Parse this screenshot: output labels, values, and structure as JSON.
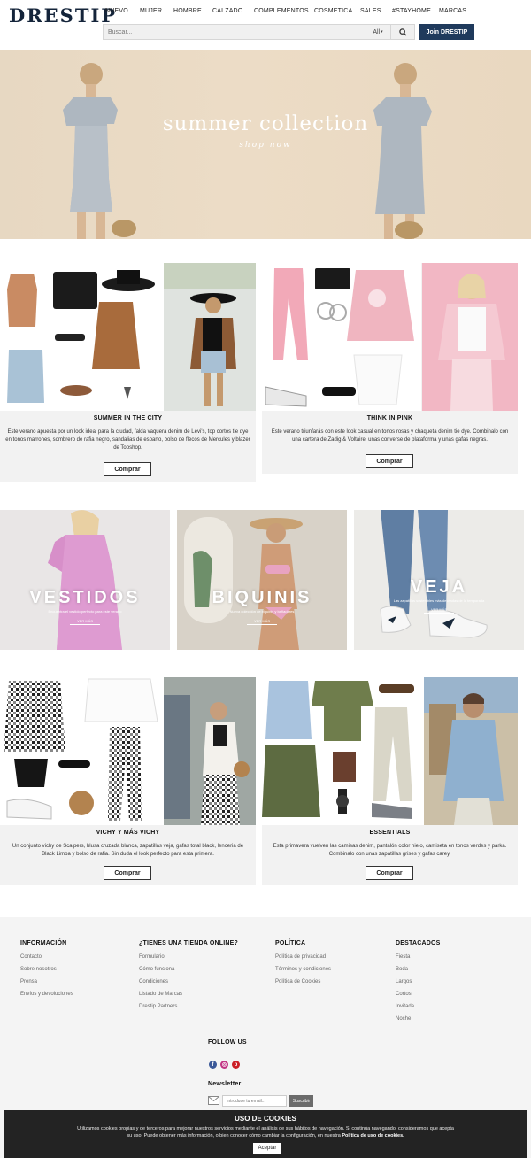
{
  "header": {
    "logo": "DRESTIP",
    "nav": [
      "NUEVO",
      "MUJER",
      "HOMBRE",
      "CALZADO",
      "COMPLEMENTOS",
      "COSMETICA",
      "SALES",
      "#STAYHOME",
      "MARCAS"
    ],
    "search_placeholder": "Buscar...",
    "search_scope": "All",
    "join_label": "Join DRESTIP"
  },
  "hero": {
    "title": "summer collection",
    "subtitle": "shop now"
  },
  "looks": [
    {
      "title": "SUMMER IN THE CITY",
      "desc": "Este verano apuesta por un look ideal para la ciudad, falda vaquera denim de Levi's, top cortos tie dye en tonos marrones, sombrero de rafia negro, sandalias de esparto, bolso de flecos de Mercules y blazer de Topshop.",
      "button": "Comprar"
    },
    {
      "title": "THINK IN PINK",
      "desc": "Este verano triunfarás con este look casual en tonos rosas y chaqueta denim tie dye. Combinalo con una cartera de Zadig & Voltaire, unas converse de plataforma y unas gafas negras.",
      "button": "Comprar"
    },
    {
      "title": "VICHY Y MÁS VICHY",
      "desc": "Un conjunto vichy de Scalpers, blusa cruzada blanca, zapatillas veja, gafas total black, lenceria de Black Limba y bolso de rafia. Sin duda el look perfecto para esta primera.",
      "button": "Comprar"
    },
    {
      "title": "ESSENTIALS",
      "desc": "Esta primavera vuelven las camisas denim, pantalón color hielo, camiseta en tonos verdes y parka. Combinalo con unas zapatillas grises y gafas carey.",
      "button": "Comprar"
    }
  ],
  "categories": [
    {
      "title": "VESTIDOS",
      "subtitle": "Encuentra el vestido perfecto para este verano",
      "link": "VER MÁS"
    },
    {
      "title": "BIQUINIS",
      "subtitle": "Nueva colección de biquinis y bañadores",
      "link": "VER MÁS"
    },
    {
      "title": "VEJA",
      "subtitle": "Las zapatillas sostenibles más deseadas de la temporada",
      "link": "VER MÁS"
    }
  ],
  "footer": {
    "columns": [
      {
        "title": "INFORMACIÓN",
        "links": [
          "Contacto",
          "Sobre nosotros",
          "Prensa",
          "Envíos y devoluciones"
        ]
      },
      {
        "title": "¿TIENES UNA TIENDA ONLINE?",
        "links": [
          "Formulario",
          "Cómo funciona",
          "Condiciones",
          "Listado de Marcas",
          "Drestip Partners"
        ]
      },
      {
        "title": "POLÍTICA",
        "links": [
          "Política de privacidad",
          "Términos y condiciones",
          "Política de Cookies"
        ]
      },
      {
        "title": "DESTACADOS",
        "links": [
          "Fiesta",
          "Boda",
          "Largos",
          "Cortos",
          "Invitada",
          "Noche"
        ]
      }
    ],
    "follow_title": "FOLLOW US",
    "newsletter_title": "Newsletter",
    "newsletter_placeholder": "Introduce tu email...",
    "subscribe_label": "Suscribir"
  },
  "cookie": {
    "title": "USO DE COOKIES",
    "text": "Utilizamos cookies propias y de terceros para mejorar nuestros servicios mediante el análisis de sus hábitos de navegación. Si continúa navegando, consideramos que acepta su uso. Puede obtener más información, o bien conocer cómo cambiar la configuración, en nuestra",
    "link": "Política de uso de cookies.",
    "accept": "Aceptar"
  },
  "colors": {
    "brand": "#1f3a5c",
    "card_bg": "#f2f2f2",
    "footer_bg": "#f4f4f4",
    "cookie_bg": "#232323"
  }
}
